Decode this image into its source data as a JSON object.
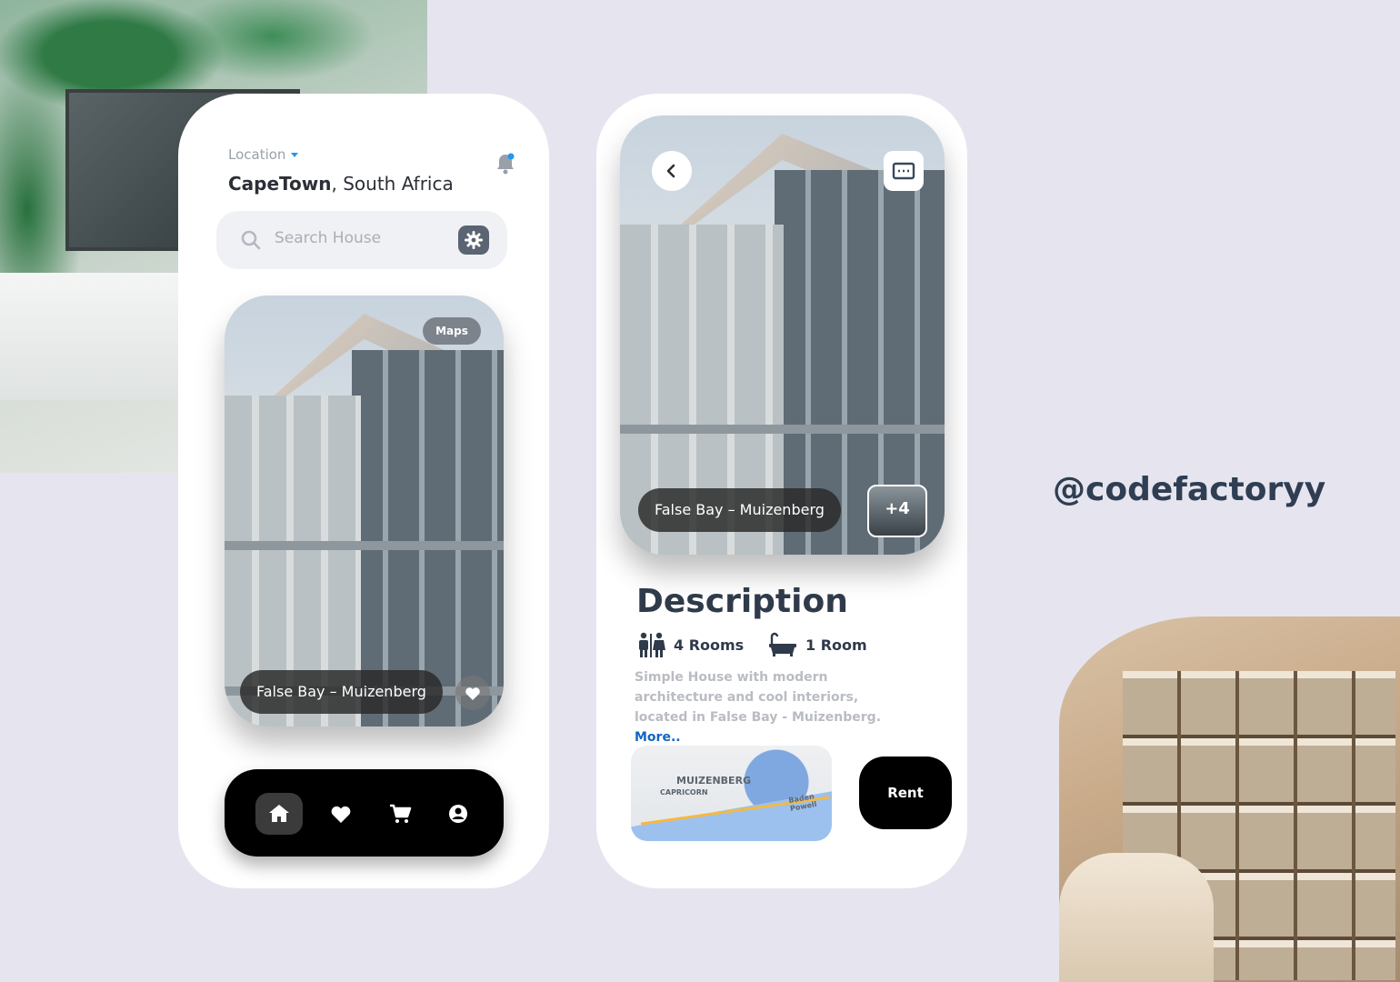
{
  "home": {
    "location_label": "Location",
    "city": "CapeTown",
    "country": ", South Africa",
    "search_placeholder": "Search House",
    "card": {
      "maps_label": "Maps",
      "title": "False Bay – Muizenberg"
    },
    "nav": [
      "home-icon",
      "heart-icon",
      "cart-icon",
      "user-icon"
    ]
  },
  "detail": {
    "card": {
      "title": "False Bay – Muizenberg",
      "more_photos": "+4"
    },
    "description_title": "Description",
    "rooms_label": "4 Rooms",
    "bath_label": "1 Room",
    "description_text": "Simple House with modern architecture and cool interiors, located in False Bay - Muizenberg.",
    "more_link": "More..",
    "map_labels": {
      "area": "MUIZENBERG",
      "sub": "CAPRICORN",
      "road": "Baden Powell"
    },
    "rent_label": "Rent"
  },
  "handle": "@codefactoryy",
  "colors": {
    "accent": "#2196f3",
    "dark": "#2f3a4a",
    "link": "#1565c0"
  }
}
